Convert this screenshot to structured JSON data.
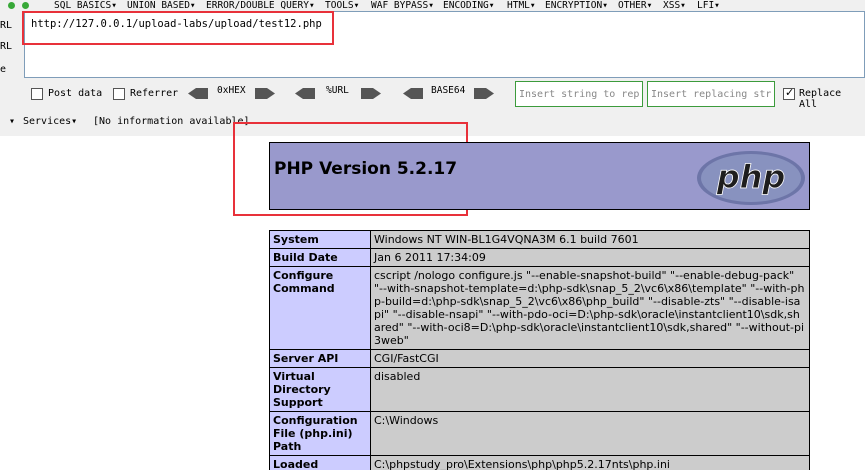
{
  "hackbar": {
    "menus": [
      "SQL BASICS▾",
      "UNION BASED▾",
      "ERROR/DOUBLE QUERY▾",
      "TOOLS▾",
      "WAF BYPASS▾",
      "ENCODING▾",
      "HTML▾",
      "ENCRYPTION▾",
      "OTHER▾",
      "XSS▾",
      "LFI▾"
    ],
    "side_labels": [
      "RL",
      "RL",
      "e"
    ],
    "url": "http://127.0.0.1/upload-labs/upload/test12.php",
    "post_data_label": "Post data",
    "referrer_label": "Referrer",
    "hex_label": "0xHEX",
    "url_enc_label": "%URL",
    "base64_label": "BASE64",
    "replace_find_placeholder": "Insert string to replace",
    "replace_with_placeholder": "Insert replacing string",
    "replace_all_label": "Replace All",
    "services_label": "Services▾",
    "info_text": "[No information available]"
  },
  "phpinfo": {
    "version_title": "PHP Version 5.2.17",
    "logo_text": "php",
    "rows": [
      {
        "key": "System",
        "value": "Windows NT WIN-BL1G4VQNA3M 6.1 build 7601"
      },
      {
        "key": "Build Date",
        "value": "Jan 6 2011 17:34:09"
      },
      {
        "key": "Configure Command",
        "value": "cscript /nologo configure.js \"--enable-snapshot-build\" \"--enable-debug-pack\" \"--with-snapshot-template=d:\\php-sdk\\snap_5_2\\vc6\\x86\\template\" \"--with-php-build=d:\\php-sdk\\snap_5_2\\vc6\\x86\\php_build\" \"--disable-zts\" \"--disable-isapi\" \"--disable-nsapi\" \"--with-pdo-oci=D:\\php-sdk\\oracle\\instantclient10\\sdk,shared\" \"--with-oci8=D:\\php-sdk\\oracle\\instantclient10\\sdk,shared\" \"--without-pi3web\""
      },
      {
        "key": "Server API",
        "value": "CGI/FastCGI"
      },
      {
        "key": "Virtual Directory Support",
        "value": "disabled"
      },
      {
        "key": "Configuration File (php.ini) Path",
        "value": "C:\\Windows"
      },
      {
        "key": "Loaded",
        "value": "C:\\phpstudy_pro\\Extensions\\php\\php5.2.17nts\\php.ini"
      }
    ]
  },
  "colors": {
    "php_header": "#9999cc",
    "table_key": "#ccccff",
    "table_value": "#cccccc",
    "annotation": "#e8313a",
    "green_border": "#3c9b3c"
  }
}
